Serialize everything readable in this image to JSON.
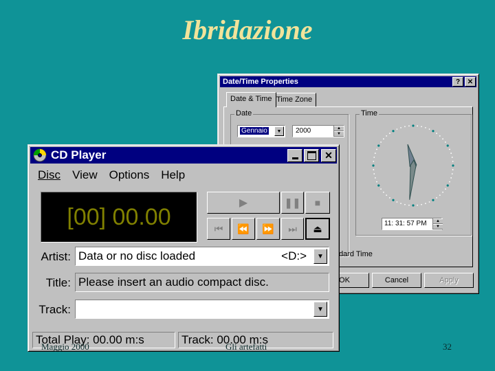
{
  "slide": {
    "title": "Ibridazione",
    "footer_left": "Maggio 2000",
    "footer_center": "Gli artefatti",
    "page_number": "32"
  },
  "datetime": {
    "title": "Date/Time Properties",
    "help_glyph": "?",
    "close_glyph": "✕",
    "tabs": [
      "Date & Time",
      "Time Zone"
    ],
    "active_tab": "Date & Time",
    "date_group": "Date",
    "time_group": "Time",
    "month_value": "Gennaio",
    "year_value": "2000",
    "time_value": "11: 31: 57 PM",
    "daylight_text": "dard Time",
    "buttons": [
      "OK",
      "Cancel",
      "Apply"
    ],
    "clock_time": {
      "hour": 11,
      "minute": 31,
      "second": 57
    }
  },
  "cd": {
    "title": "CD Player",
    "menu": [
      "Disc",
      "View",
      "Options",
      "Help"
    ],
    "display": "[00] 00.00",
    "artist_label": "Artist:",
    "artist_value": "Data or no disc loaded",
    "artist_drive": "<D:>",
    "title_label": "Title:",
    "title_value": "Please insert an audio compact disc.",
    "track_label": "Track:",
    "track_value": "",
    "status_total": "Total Play: 00.00 m:s",
    "status_track": "Track: 00.00 m:s",
    "icons": {
      "play": "play-icon",
      "pause": "pause-icon",
      "stop": "stop-icon",
      "prev": "previous-track-icon",
      "rew": "rewind-icon",
      "ff": "fast-forward-icon",
      "next": "next-track-icon",
      "eject": "eject-icon"
    },
    "colors": {
      "titlebar": "#000080",
      "lcd_text": "#808000",
      "lcd_bg": "#000000"
    }
  }
}
